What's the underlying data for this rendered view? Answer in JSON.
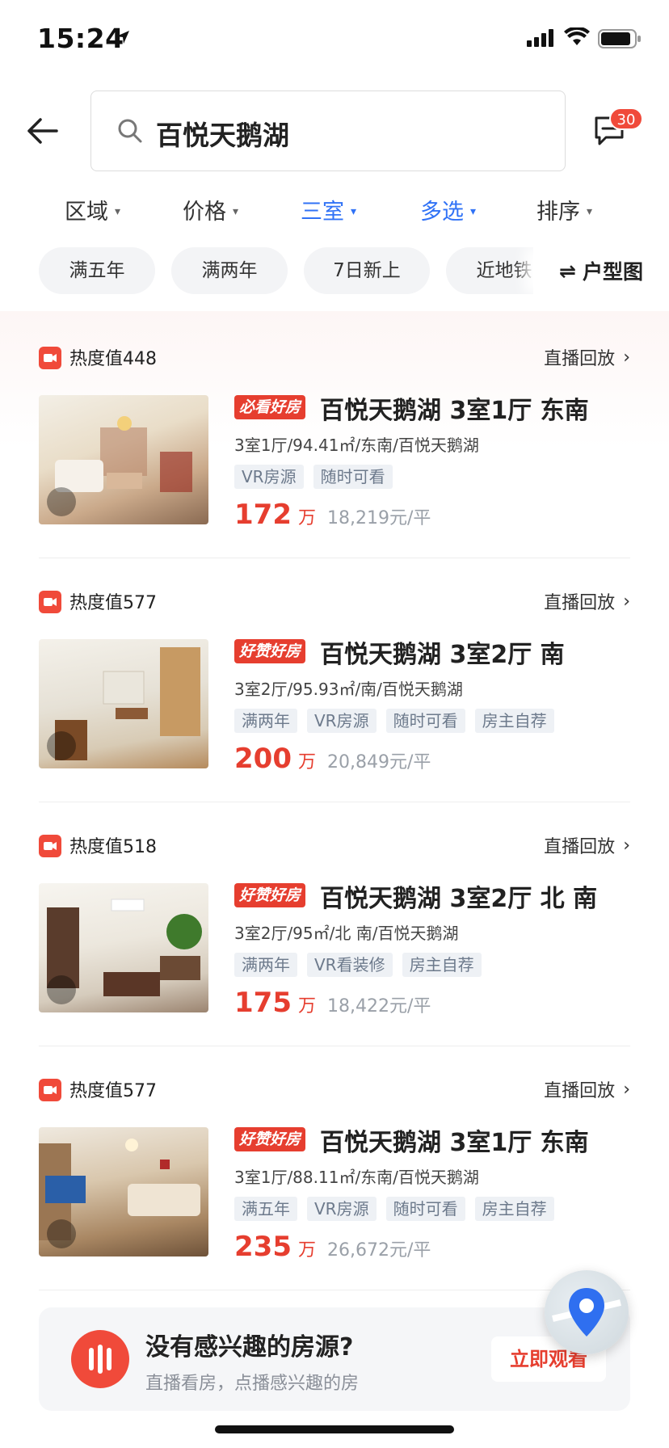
{
  "status_bar": {
    "time": "15:24"
  },
  "search": {
    "query": "百悦天鹅湖"
  },
  "header": {
    "message_badge": "30"
  },
  "filters": [
    {
      "label": "区域",
      "active": false
    },
    {
      "label": "价格",
      "active": false
    },
    {
      "label": "三室",
      "active": true
    },
    {
      "label": "多选",
      "active": true
    },
    {
      "label": "排序",
      "active": false
    }
  ],
  "chips": [
    "满五年",
    "满两年",
    "7日新上",
    "近地铁"
  ],
  "layout_button": "户型图",
  "listings": [
    {
      "heat": "热度值448",
      "replay": "直播回放",
      "tag": "必看好房",
      "title": "百悦天鹅湖 3室1厅 东南",
      "meta": "3室1厅/94.41㎡/东南/百悦天鹅湖",
      "features": [
        "VR房源",
        "随时可看"
      ],
      "price": "172",
      "price_unit": "万",
      "price_per": "18,219元/平"
    },
    {
      "heat": "热度值577",
      "replay": "直播回放",
      "tag": "好赞好房",
      "title": "百悦天鹅湖 3室2厅 南",
      "meta": "3室2厅/95.93㎡/南/百悦天鹅湖",
      "features": [
        "满两年",
        "VR房源",
        "随时可看",
        "房主自荐"
      ],
      "price": "200",
      "price_unit": "万",
      "price_per": "20,849元/平"
    },
    {
      "heat": "热度值518",
      "replay": "直播回放",
      "tag": "好赞好房",
      "title": "百悦天鹅湖 3室2厅 北 南",
      "meta": "3室2厅/95㎡/北 南/百悦天鹅湖",
      "features": [
        "满两年",
        "VR看装修",
        "房主自荐"
      ],
      "price": "175",
      "price_unit": "万",
      "price_per": "18,422元/平"
    },
    {
      "heat": "热度值577",
      "replay": "直播回放",
      "tag": "好赞好房",
      "title": "百悦天鹅湖 3室1厅 东南",
      "meta": "3室1厅/88.11㎡/东南/百悦天鹅湖",
      "features": [
        "满五年",
        "VR房源",
        "随时可看",
        "房主自荐"
      ],
      "price": "235",
      "price_unit": "万",
      "price_per": "26,672元/平"
    }
  ],
  "promo": {
    "title": "没有感兴趣的房源?",
    "subtitle": "直播看房，点播感兴趣的房",
    "button": "立即观看"
  },
  "colors": {
    "accent_red": "#e63e2f",
    "accent_blue": "#3072f6"
  }
}
